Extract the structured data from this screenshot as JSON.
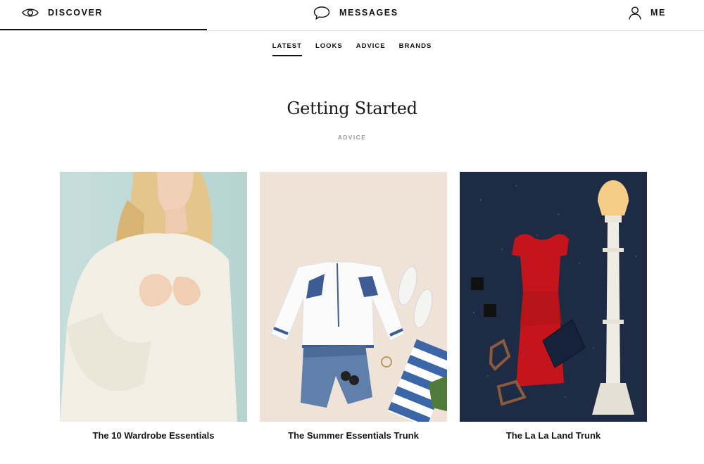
{
  "nav": {
    "discover_label": "DISCOVER",
    "messages_label": "MESSAGES",
    "me_label": "ME"
  },
  "subnav": {
    "tabs": [
      {
        "label": "LATEST",
        "active": true
      },
      {
        "label": "LOOKS",
        "active": false
      },
      {
        "label": "ADVICE",
        "active": false
      },
      {
        "label": "BRANDS",
        "active": false
      }
    ]
  },
  "section": {
    "title": "Getting Started",
    "category": "ADVICE"
  },
  "cards": [
    {
      "caption": "The 10 Wardrobe Essentials",
      "image": "woman-in-white-sweater"
    },
    {
      "caption": "The Summer Essentials Trunk",
      "image": "summer-outfit-flatlay"
    },
    {
      "caption": "The La La Land Trunk",
      "image": "red-dress-lamppost-flatlay"
    }
  ],
  "colors": {
    "text": "#111111",
    "muted": "#9a9a9a",
    "divider": "#e2e2e2"
  }
}
